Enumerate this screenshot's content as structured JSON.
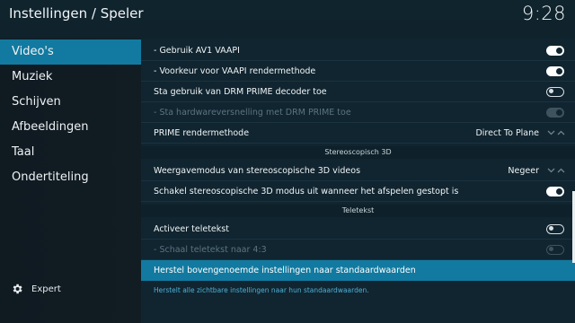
{
  "header": {
    "title": "Instellingen / Speler",
    "clock": "9:28"
  },
  "sidebar": {
    "items": [
      {
        "label": "Video's",
        "active": true
      },
      {
        "label": "Muziek"
      },
      {
        "label": "Schijven"
      },
      {
        "label": "Afbeeldingen"
      },
      {
        "label": "Taal"
      },
      {
        "label": "Ondertiteling"
      }
    ],
    "expert_label": "Expert"
  },
  "settings": {
    "rows": [
      {
        "label": "- Gebruik AV1 VAAPI",
        "control": "toggle",
        "state": "on"
      },
      {
        "label": "- Voorkeur voor VAAPI rendermethode",
        "control": "toggle",
        "state": "on"
      },
      {
        "label": "Sta gebruik van DRM PRIME decoder toe",
        "control": "toggle",
        "state": "off"
      },
      {
        "label": "- Sta hardwareversnelling met DRM PRIME toe",
        "control": "toggle",
        "state": "on",
        "disabled": true
      },
      {
        "label": "PRIME rendermethode",
        "control": "spinner",
        "value": "Direct To Plane"
      }
    ],
    "section_stereo": "Stereoscopisch 3D",
    "stereo_rows": [
      {
        "label": "Weergavemodus van stereoscopische 3D videos",
        "control": "spinner",
        "value": "Negeer"
      },
      {
        "label": "Schakel stereoscopische 3D modus uit wanneer het afspelen gestopt is",
        "control": "toggle",
        "state": "on"
      }
    ],
    "section_teletext": "Teletekst",
    "teletext_rows": [
      {
        "label": "Activeer teletekst",
        "control": "toggle",
        "state": "off"
      },
      {
        "label": "- Schaal teletekst naar 4:3",
        "control": "toggle",
        "state": "off",
        "disabled": true
      }
    ],
    "reset_label": "Herstel bovengenoemde instellingen naar standaardwaarden",
    "description": "Herstelt alle zichtbare instellingen naar hun standaardwaarden."
  },
  "colors": {
    "accent": "#127aa0",
    "background": "#102530",
    "description_text": "#4fb0d6"
  }
}
